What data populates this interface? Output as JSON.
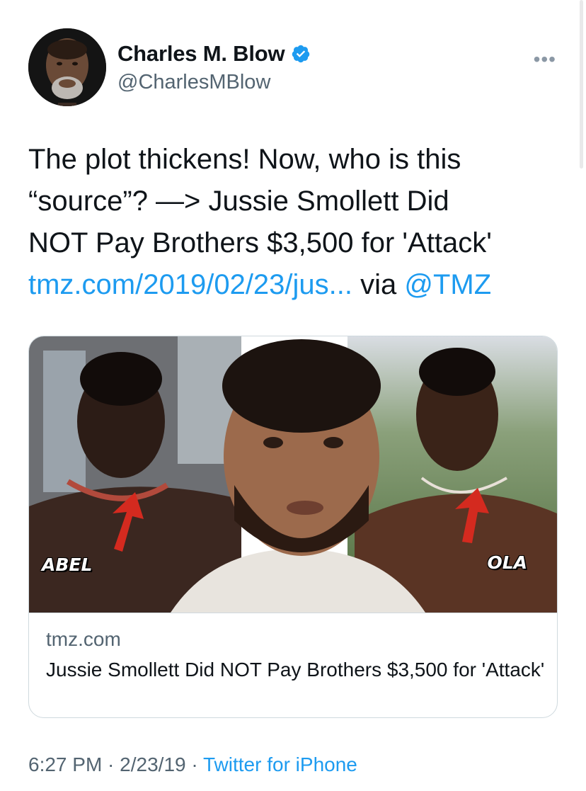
{
  "author": {
    "display_name": "Charles M. Blow",
    "handle": "@CharlesMBlow",
    "verified": true,
    "avatar_icon": "profile-photo"
  },
  "more_label": "•••",
  "tweet": {
    "lines": [
      "The plot thickens! Now, who is this",
      "“source”? —> Jussie Smollett Did",
      "NOT Pay Brothers $3,500 for 'Attack'"
    ],
    "link_text": "tmz.com/2019/02/23/jus...",
    "via_text": " via ",
    "mention": "@TMZ"
  },
  "card": {
    "domain": "tmz.com",
    "title": "Jussie Smollett Did NOT Pay Brothers $3,500 for 'Attack'",
    "image_labels": {
      "left": "ABEL",
      "right": "OLA"
    }
  },
  "footer": {
    "time": "6:27 PM",
    "separator": " · ",
    "date": "2/23/19",
    "source": "Twitter for iPhone"
  },
  "colors": {
    "accent": "#1d9bf0",
    "secondary_text": "#536471",
    "border": "#cfd9de"
  }
}
